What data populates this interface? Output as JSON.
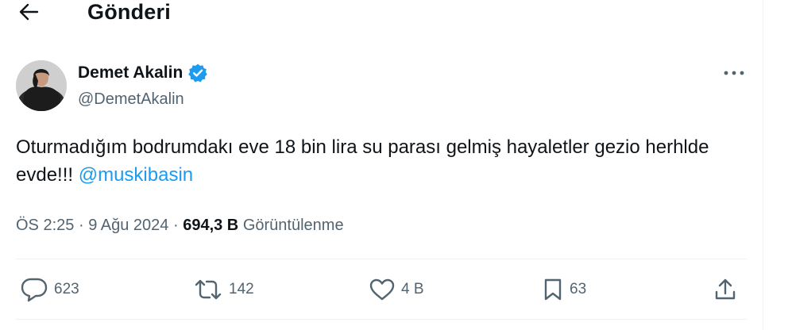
{
  "header": {
    "title": "Gönderi"
  },
  "author": {
    "name": "Demet Akalin",
    "handle": "@DemetAkalin"
  },
  "tweet": {
    "text": "Oturmadığım bodrumdakı eve 18 bin lira su parası gelmiş hayaletler gezio herhlde evde!!!",
    "mention": "@muskibasin"
  },
  "meta": {
    "time": "ÖS 2:25",
    "separator": "·",
    "date": "9 Ağu 2024",
    "views_count": "694,3 B",
    "views_label": "Görüntülenme"
  },
  "actions": {
    "replies": "623",
    "reposts": "142",
    "likes": "4 B",
    "bookmarks": "63"
  },
  "colors": {
    "accent": "#1d9bf0",
    "secondary_text": "#536471",
    "primary_text": "#0f1419",
    "divider": "#eff3f4"
  }
}
